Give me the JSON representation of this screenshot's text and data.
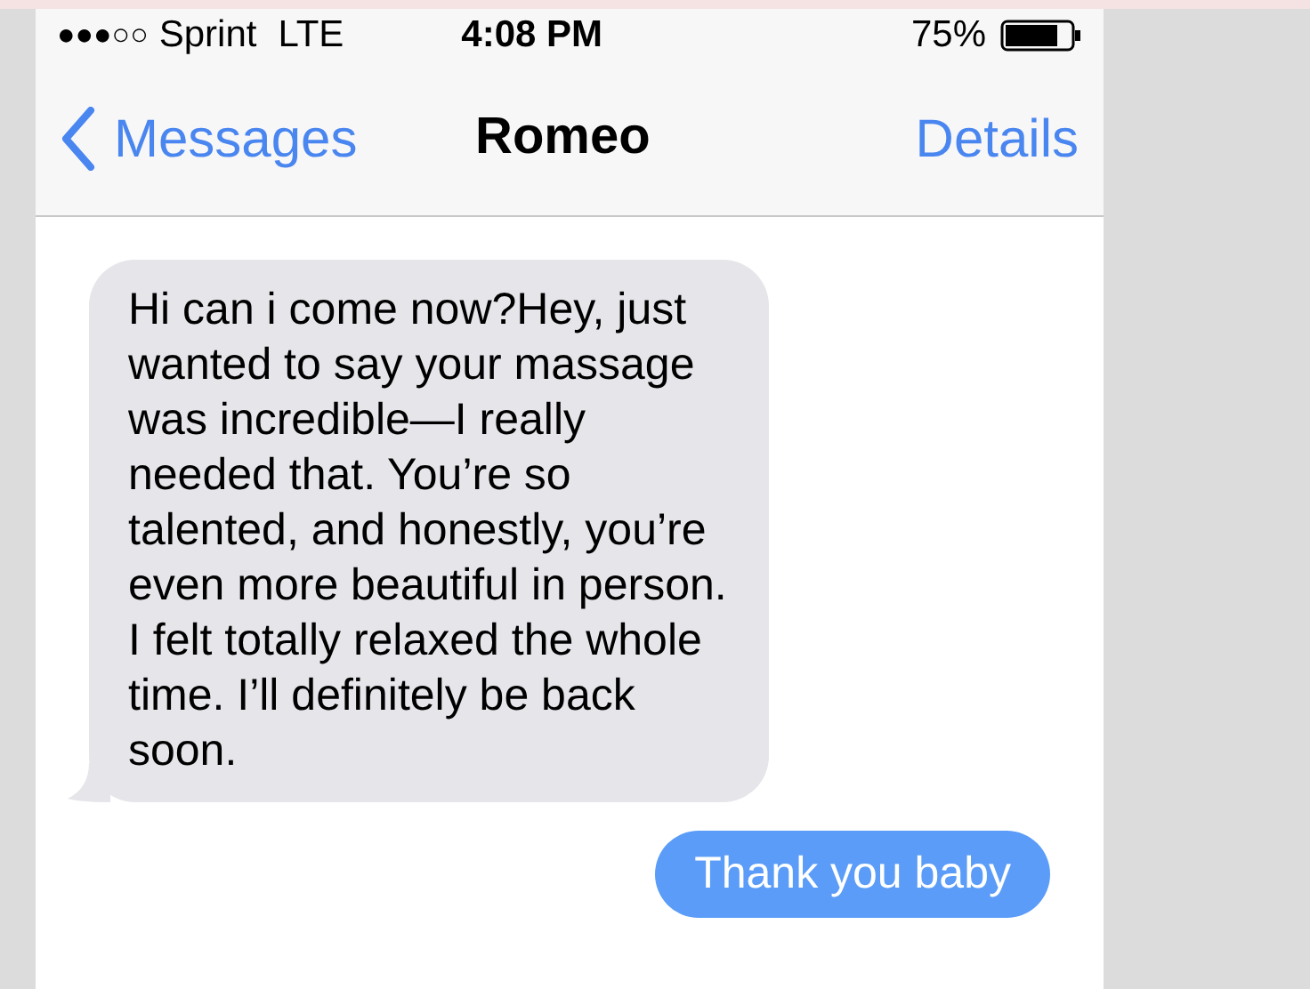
{
  "status_bar": {
    "signal": "●●●○○",
    "carrier": "Sprint",
    "network": "LTE",
    "time": "4:08 PM",
    "battery": "75%"
  },
  "nav_bar": {
    "back": "Messages",
    "title": "Romeo",
    "action": "Details"
  },
  "messages": [
    {
      "kind": "received",
      "text": "Hi can i come now?Hey, just wanted to say your massage was incredible—I really needed that. You’re so talented, and honestly, you’re even more beautiful in person. I felt totally relaxed the whole time. I’ll definitely be back soon."
    },
    {
      "kind": "sent",
      "text": "Thank you baby"
    }
  ]
}
